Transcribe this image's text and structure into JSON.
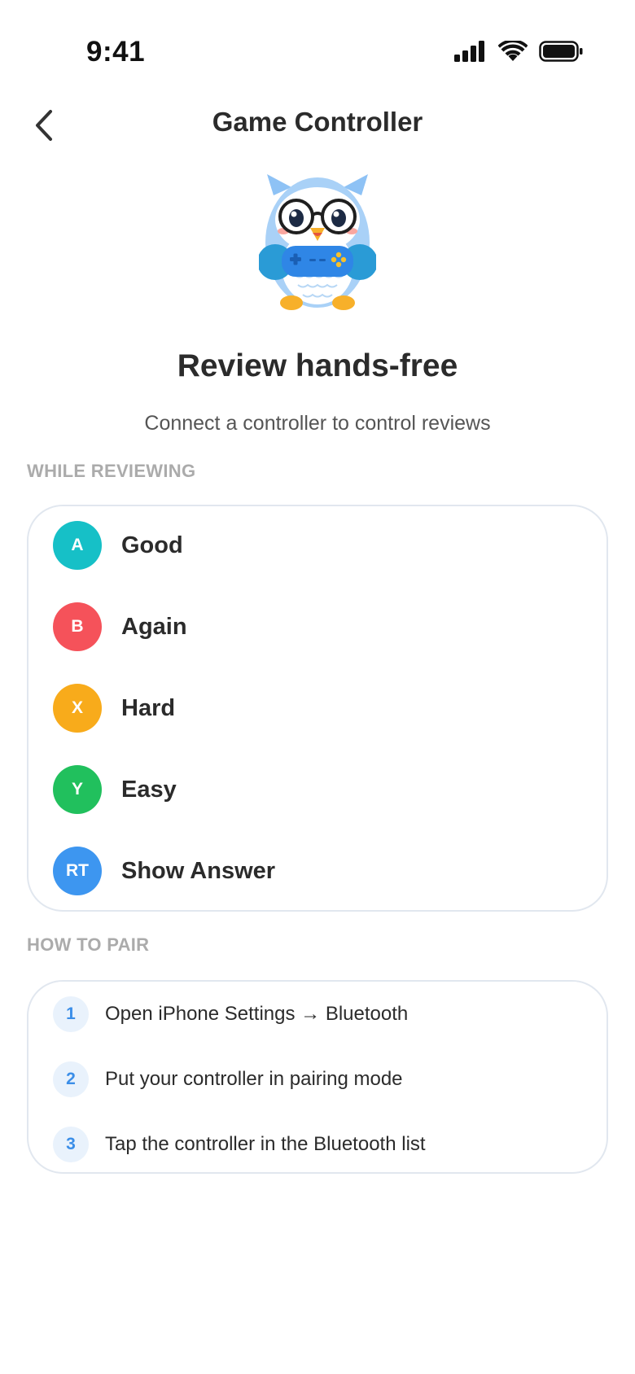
{
  "status_bar": {
    "time": "9:41"
  },
  "nav": {
    "title": "Game Controller"
  },
  "hero": {
    "title": "Review hands-free",
    "subtitle": "Connect a controller to control reviews"
  },
  "reviewing": {
    "label": "WHILE REVIEWING",
    "items": [
      {
        "button": "A",
        "action": "Good",
        "color": "#16c0c7"
      },
      {
        "button": "B",
        "action": "Again",
        "color": "#f5525a"
      },
      {
        "button": "X",
        "action": "Hard",
        "color": "#f8ab1b"
      },
      {
        "button": "Y",
        "action": "Easy",
        "color": "#21c05d"
      },
      {
        "button": "RT",
        "action": "Show Answer",
        "color": "#3d96f0"
      }
    ]
  },
  "pairing": {
    "label": "HOW TO PAIR",
    "steps": [
      {
        "num": "1",
        "text": "Open iPhone Settings → Bluetooth"
      },
      {
        "num": "2",
        "text": "Put your controller in pairing mode"
      },
      {
        "num": "3",
        "text": "Tap the controller in the Bluetooth list"
      }
    ]
  },
  "colors": {
    "accent": "#3b8ee8",
    "border": "#e1e7ef",
    "section_label": "#ababab"
  }
}
